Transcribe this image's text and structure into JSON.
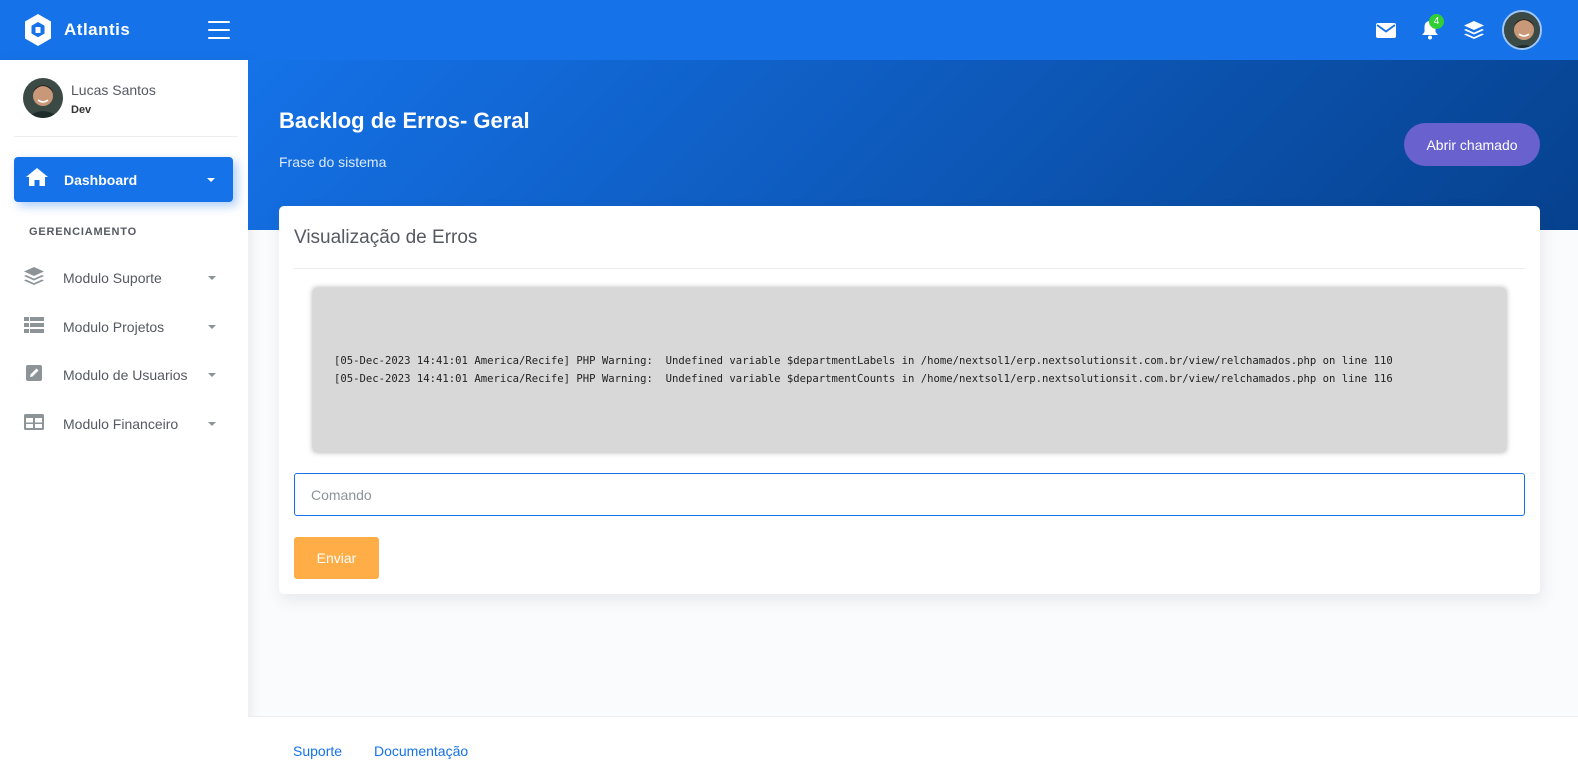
{
  "brand": {
    "name": "Atlantis",
    "logo_icon": "atlantis-logo-icon",
    "menu_icon": "hamburger-icon"
  },
  "topbar": {
    "icons": [
      "envelope-icon",
      "bell-icon",
      "layers-icon"
    ],
    "notification_count": "4"
  },
  "user": {
    "name": "Lucas Santos",
    "role": "Dev"
  },
  "sidebar": {
    "active": {
      "label": "Dashboard",
      "icon": "home-icon"
    },
    "section_title": "GERENCIAMENTO",
    "items": [
      {
        "label": "Modulo Suporte",
        "icon": "layers-icon"
      },
      {
        "label": "Modulo Projetos",
        "icon": "table-icon"
      },
      {
        "label": "Modulo de Usuarios",
        "icon": "pen-square-icon"
      },
      {
        "label": "Modulo Financeiro",
        "icon": "grid-icon"
      }
    ]
  },
  "header": {
    "title": "Backlog de Erros- Geral",
    "subtitle": "Frase do sistema",
    "ticket_button": "Abrir chamado"
  },
  "card": {
    "title": "Visualização de Erros",
    "log_lines": [
      "[05-Dec-2023 14:41:01 America/Recife] PHP Warning:  Undefined variable $departmentLabels in /home/nextsol1/erp.nextsolutionsit.com.br/view/relchamados.php on line 110",
      "[05-Dec-2023 14:41:01 America/Recife] PHP Warning:  Undefined variable $departmentCounts in /home/nextsol1/erp.nextsolutionsit.com.br/view/relchamados.php on line 116"
    ],
    "command_placeholder": "Comando",
    "command_value": "",
    "send_button": "Enviar"
  },
  "footer": {
    "links": [
      "Suporte",
      "Documentação"
    ]
  },
  "colors": {
    "primary": "#1572e8",
    "primary_dark": "#06418e",
    "secondary": "#6861ce",
    "warning": "#ffad46",
    "success": "#31ce36"
  }
}
